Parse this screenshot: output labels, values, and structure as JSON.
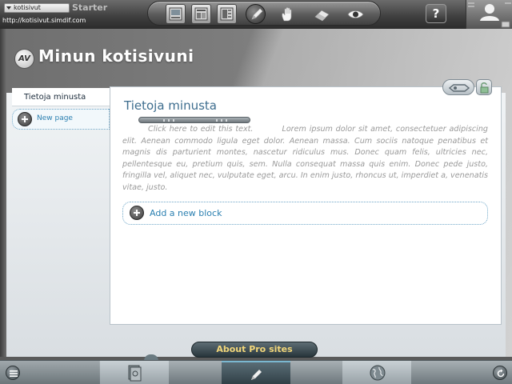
{
  "topbar": {
    "site_name": "kotisivut",
    "plan": "Starter",
    "url": "http://kotisivut.simdif.com",
    "help_label": "?"
  },
  "toolbar": {
    "tools": [
      "layout-photo-icon",
      "layout-columns-icon",
      "layout-page-icon",
      "pencil-icon",
      "hand-icon",
      "eraser-icon",
      "eye-icon"
    ]
  },
  "site": {
    "logo_text": "AV",
    "title": "Minun kotisivuni"
  },
  "nav": {
    "items": [
      {
        "label": "Tietoja minusta"
      }
    ],
    "new_page_label": "New page"
  },
  "page": {
    "heading": "Tietoja minusta",
    "edit_hint": "Click here to edit this text.",
    "body": "Lorem ipsum dolor sit amet, consectetuer adipiscing elit. Aenean commodo ligula eget dolor. Aenean massa. Cum sociis natoque penatibus et magnis dis parturient montes, nascetur ridiculus mus. Donec quam felis, ultricies nec, pellentesque eu, pretium quis, sem. Nulla consequat massa quis enim. Donec pede justo, fringilla vel, aliquet nec, vulputate eget, arcu. In enim justo, rhoncus ut, imperdiet a, venenatis vitae, justo.",
    "add_block_label": "Add a new block"
  },
  "bottom": {
    "pro_label": "About Pro sites"
  },
  "colors": {
    "accent": "#2a7fb0",
    "heading": "#3d6d8e",
    "pro_text": "#f2d77a"
  }
}
